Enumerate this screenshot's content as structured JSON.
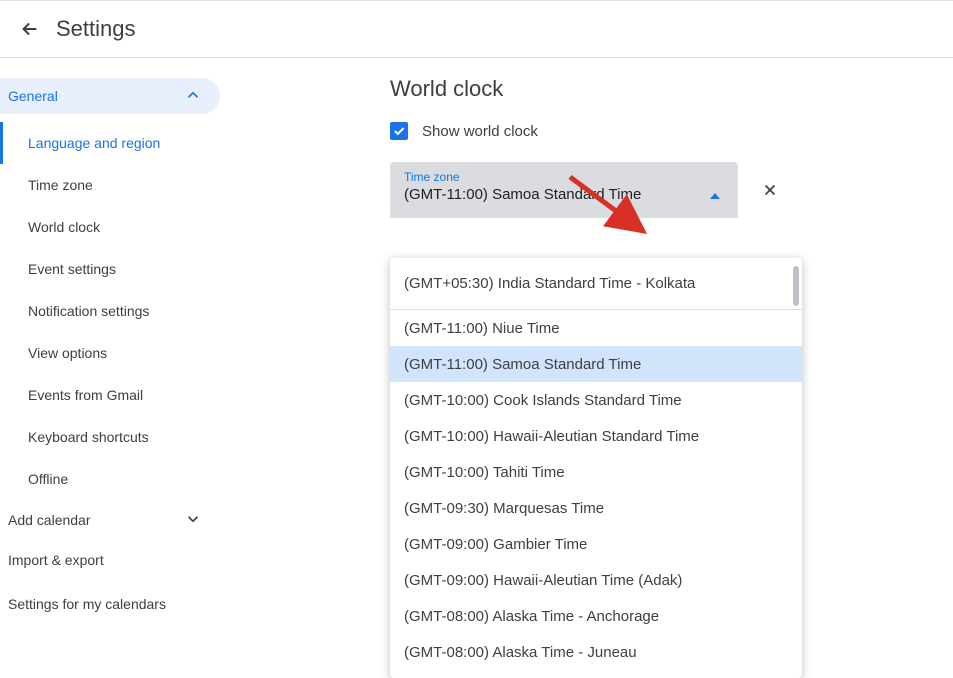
{
  "header": {
    "title": "Settings"
  },
  "sidebar": {
    "section_label": "General",
    "items": [
      {
        "label": "Language and region",
        "active": true
      },
      {
        "label": "Time zone",
        "active": false
      },
      {
        "label": "World clock",
        "active": false
      },
      {
        "label": "Event settings",
        "active": false
      },
      {
        "label": "Notification settings",
        "active": false
      },
      {
        "label": "View options",
        "active": false
      },
      {
        "label": "Events from Gmail",
        "active": false
      },
      {
        "label": "Keyboard shortcuts",
        "active": false
      },
      {
        "label": "Offline",
        "active": false
      }
    ],
    "add_calendar": "Add calendar",
    "import_export": "Import & export",
    "footer": "Settings for my calendars"
  },
  "main": {
    "section_title": "World clock",
    "checkbox_label": "Show world clock",
    "checkbox_checked": true,
    "dropdown": {
      "label": "Time zone",
      "value": "(GMT-11:00) Samoa Standard Time"
    },
    "menu": {
      "header_item": "(GMT+05:30) India Standard Time - Kolkata",
      "options": [
        {
          "label": "(GMT-11:00) Niue Time",
          "selected": false
        },
        {
          "label": "(GMT-11:00) Samoa Standard Time",
          "selected": true
        },
        {
          "label": "(GMT-10:00) Cook Islands Standard Time",
          "selected": false
        },
        {
          "label": "(GMT-10:00) Hawaii-Aleutian Standard Time",
          "selected": false
        },
        {
          "label": "(GMT-10:00) Tahiti Time",
          "selected": false
        },
        {
          "label": "(GMT-09:30) Marquesas Time",
          "selected": false
        },
        {
          "label": "(GMT-09:00) Gambier Time",
          "selected": false
        },
        {
          "label": "(GMT-09:00) Hawaii-Aleutian Time (Adak)",
          "selected": false
        },
        {
          "label": "(GMT-08:00) Alaska Time - Anchorage",
          "selected": false
        },
        {
          "label": "(GMT-08:00) Alaska Time - Juneau",
          "selected": false
        }
      ]
    }
  }
}
